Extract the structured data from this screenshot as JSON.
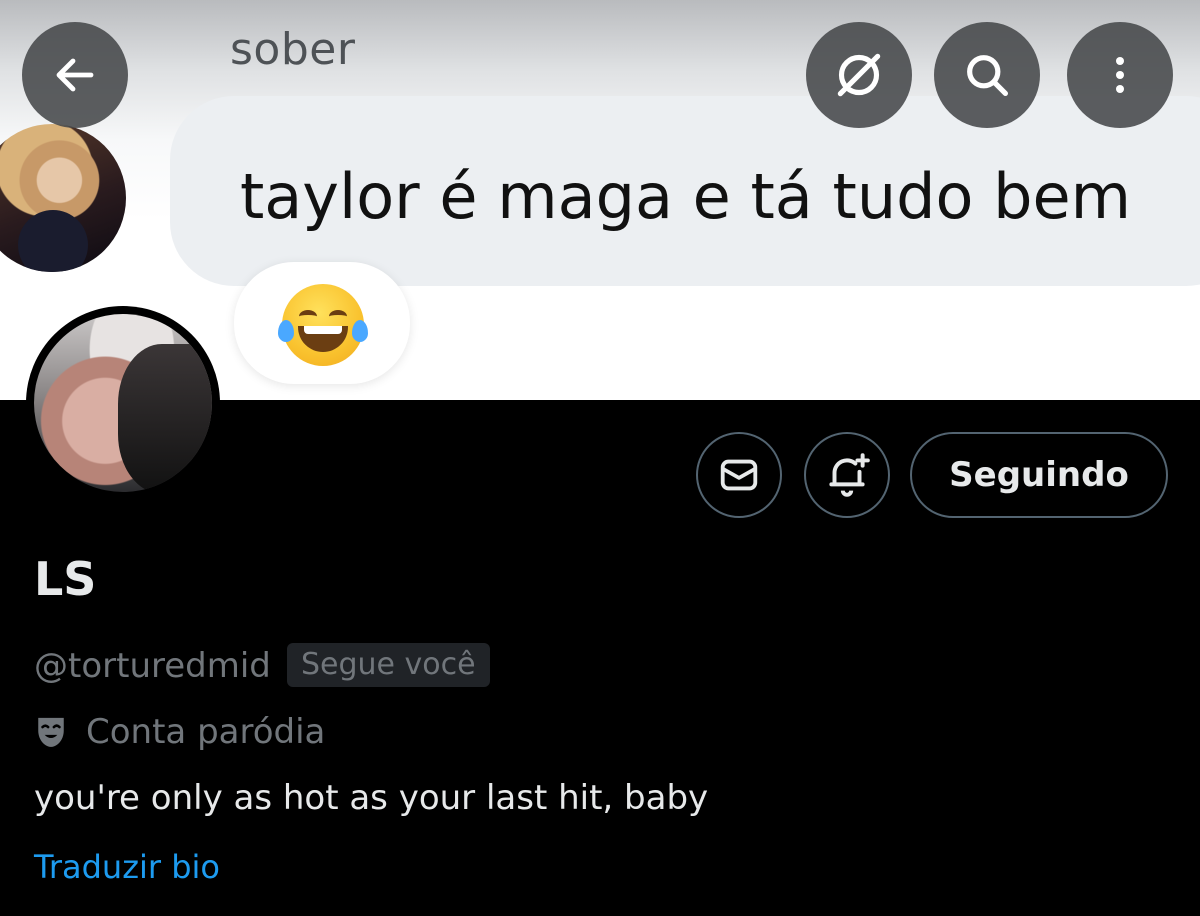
{
  "banner": {
    "sender_name": "sober",
    "message": "taylor é maga e tá tudo bem",
    "reaction_emoji": "face-with-tears-of-joy"
  },
  "topbar": {
    "back_icon": "arrow-left-icon",
    "grok_icon": "grok-icon",
    "search_icon": "search-icon",
    "more_icon": "more-vertical-icon"
  },
  "profile": {
    "display_name": "LS",
    "handle": "@torturedmid",
    "follows_you_badge": "Segue você",
    "parody_label": "Conta paródia",
    "bio": "you're only as hot as your last hit, baby",
    "translate_bio_label": "Traduzir bio"
  },
  "actions": {
    "message_icon": "envelope-icon",
    "notify_icon": "bell-plus-icon",
    "follow_label": "Seguindo"
  },
  "colors": {
    "background": "#000000",
    "primary_text": "#e7e9ea",
    "secondary_text": "#71767b",
    "link": "#1d9bf0",
    "button_border": "#536471"
  }
}
